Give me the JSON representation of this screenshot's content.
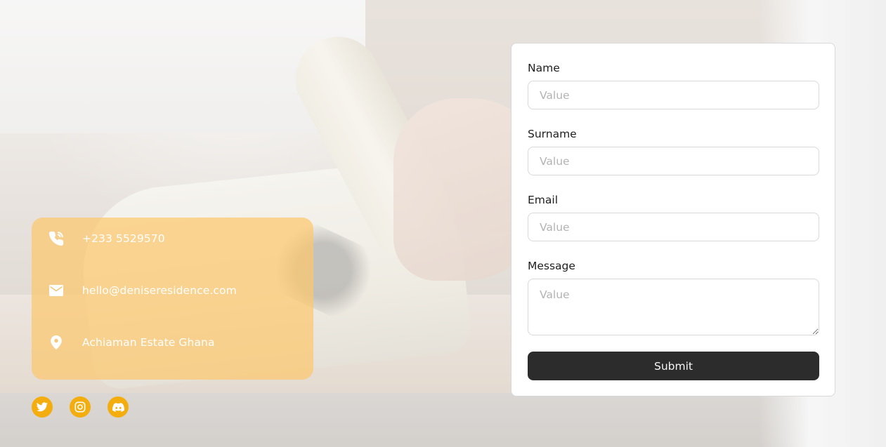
{
  "contact_info": {
    "phone": {
      "icon": "phone-call-icon",
      "text": "+233 5529570"
    },
    "email": {
      "icon": "mail-icon",
      "text": "hello@deniseresidence.com"
    },
    "location": {
      "icon": "map-pin-icon",
      "text": "Achiaman Estate Ghana"
    }
  },
  "social": [
    {
      "icon": "twitter-icon"
    },
    {
      "icon": "instagram-icon"
    },
    {
      "icon": "discord-icon"
    }
  ],
  "form": {
    "name": {
      "label": "Name",
      "placeholder": "Value",
      "value": ""
    },
    "surname": {
      "label": "Surname",
      "placeholder": "Value",
      "value": ""
    },
    "email": {
      "label": "Email",
      "placeholder": "Value",
      "value": ""
    },
    "message": {
      "label": "Message",
      "placeholder": "Value",
      "value": ""
    },
    "submit_label": "Submit"
  },
  "colors": {
    "card_accent": "#FCC86E",
    "social_accent": "#F3AD0F",
    "button_bg": "#2C2C2C"
  }
}
